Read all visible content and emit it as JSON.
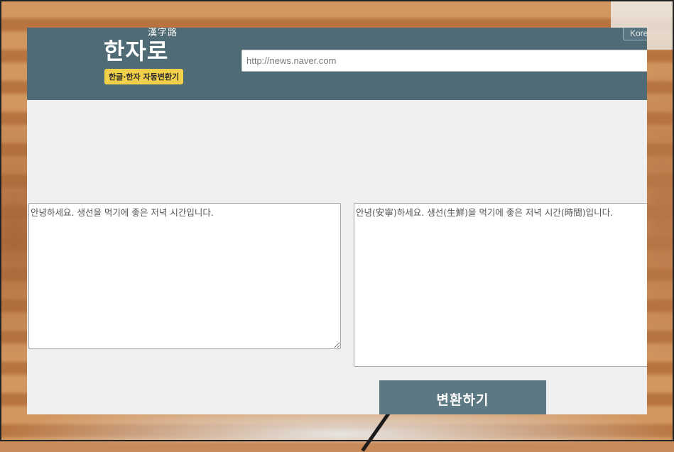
{
  "header": {
    "logo_hanja": "漢字路",
    "logo_title": "한자로",
    "logo_badge": "한글·한자 자동변환기",
    "language_button": "Kore",
    "url_placeholder": "http://news.naver.com"
  },
  "input": {
    "text": "안녕하세요. 생선을 먹기에 좋은 저녁 시간입니다."
  },
  "output": {
    "text": "안녕(安寧)하세요. 생선(生鮮)을 먹기에 좋은 저녁 시간(時間)입니다."
  },
  "actions": {
    "convert_label": "변환하기"
  },
  "colors": {
    "header_bg": "#4f6b76",
    "badge_bg": "#f2d14a",
    "button_bg": "#5c7882",
    "page_bg": "#efefef"
  }
}
